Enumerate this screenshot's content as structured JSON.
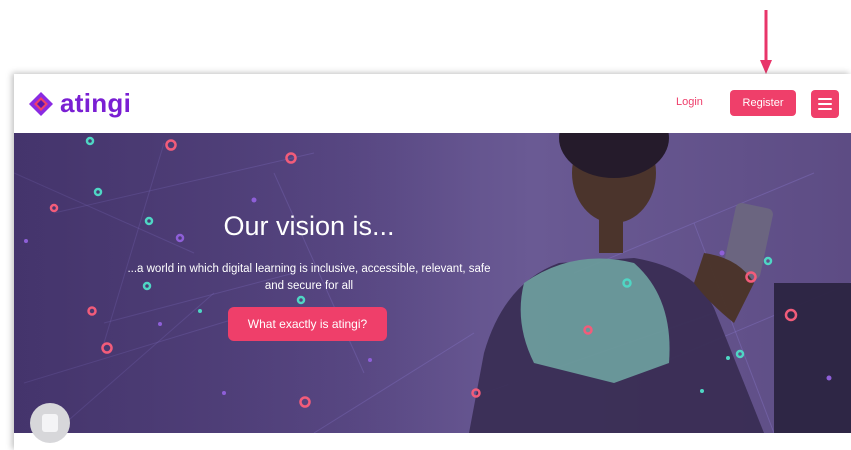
{
  "brand": {
    "name": "atingi",
    "logo_color": "#7a1fd3",
    "accent": "#ef3f6a"
  },
  "nav": {
    "login_label": "Login",
    "register_label": "Register",
    "menu_icon": "hamburger-icon"
  },
  "hero": {
    "title": "Our vision is...",
    "subtitle": "...a world in which digital learning is inclusive, accessible, relevant, safe and secure for all",
    "cta_label": "What exactly is atingi?"
  },
  "annotation": {
    "arrow_color": "#e8356a",
    "icon": "down-arrow-icon"
  },
  "chat": {
    "icon": "chat-icon"
  }
}
